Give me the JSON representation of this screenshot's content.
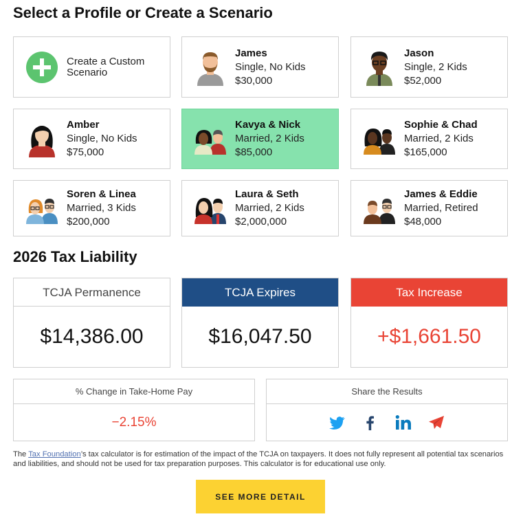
{
  "page_title": "Select a Profile or Create a Scenario",
  "profiles": [
    {
      "create_label": "Create a Custom Scenario"
    },
    {
      "name": "James",
      "status": "Single, No Kids",
      "income": "$30,000"
    },
    {
      "name": "Jason",
      "status": "Single, 2 Kids",
      "income": "$52,000"
    },
    {
      "name": "Amber",
      "status": "Single, No Kids",
      "income": "$75,000"
    },
    {
      "name": "Kavya & Nick",
      "status": "Married, 2 Kids",
      "income": "$85,000",
      "selected": true
    },
    {
      "name": "Sophie & Chad",
      "status": "Married, 2 Kids",
      "income": "$165,000"
    },
    {
      "name": "Soren & Linea",
      "status": "Married, 3 Kids",
      "income": "$200,000"
    },
    {
      "name": "Laura & Seth",
      "status": "Married, 2 Kids",
      "income": "$2,000,000"
    },
    {
      "name": "James & Eddie",
      "status": "Married, Retired",
      "income": "$48,000"
    }
  ],
  "liability": {
    "title": "2026 Tax Liability",
    "permanence": {
      "label": "TCJA Permanence",
      "value": "$14,386.00"
    },
    "expires": {
      "label": "TCJA Expires",
      "value": "$16,047.50"
    },
    "increase": {
      "label": "Tax Increase",
      "value": "+$1,661.50"
    }
  },
  "take_home": {
    "label": "% Change in Take-Home Pay",
    "value": "−2.15%"
  },
  "share": {
    "label": "Share the Results",
    "icons": [
      "twitter-icon",
      "facebook-icon",
      "linkedin-icon",
      "send-icon"
    ]
  },
  "disclaimer": {
    "link_text": "Tax Foundation",
    "before": "The ",
    "after": "’s tax calculator is for estimation of the impact of the TCJA on taxpayers. It does not fully represent all potential tax scenarios and liabilities, and should not be used for tax preparation purposes. This calculator is for educational use only."
  },
  "cta_label": "SEE MORE DETAIL",
  "colors": {
    "selected": "#86e2ad",
    "blue": "#1f4e86",
    "red": "#e94435",
    "cta": "#fcd232",
    "plus": "#5cc46f"
  }
}
